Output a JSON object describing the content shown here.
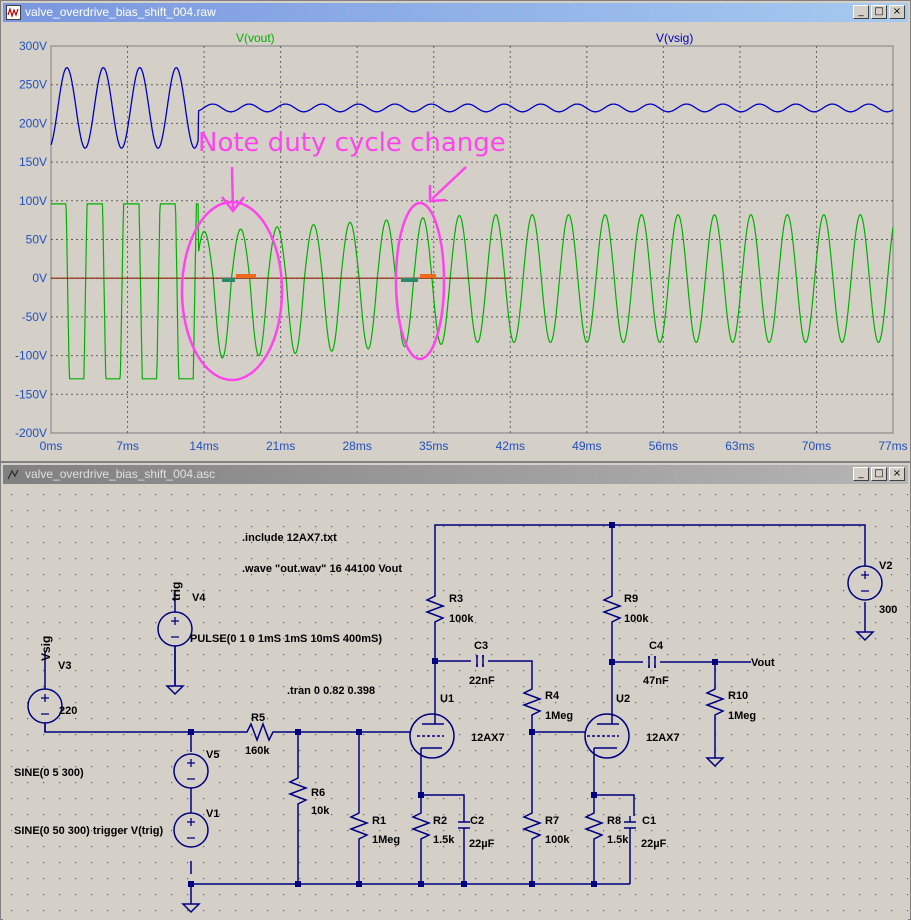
{
  "plot_window": {
    "title": "valve_overdrive_bias_shift_004.raw",
    "controls": {
      "minimize": "_",
      "maximize": "□",
      "close": "×"
    }
  },
  "schematic_window": {
    "title": "valve_overdrive_bias_shift_004.asc",
    "controls": {
      "minimize": "_",
      "maximize": "□",
      "close": "×"
    }
  },
  "chart_data": {
    "type": "line",
    "xlim": [
      0,
      77
    ],
    "ylim": [
      -200,
      300
    ],
    "grid": true,
    "x_ticks": [
      "0ms",
      "7ms",
      "14ms",
      "21ms",
      "28ms",
      "35ms",
      "42ms",
      "49ms",
      "56ms",
      "63ms",
      "70ms",
      "77ms"
    ],
    "y_ticks": [
      "300V",
      "250V",
      "200V",
      "150V",
      "100V",
      "50V",
      "0V",
      "-50V",
      "-100V",
      "-150V",
      "-200V"
    ],
    "series": [
      {
        "name": "V(vout)",
        "color": "#00b000"
      },
      {
        "name": "V(vsig)",
        "color": "#0000c0"
      }
    ],
    "reference_line": {
      "y": 0,
      "x_end": 42,
      "color": "#8b2500"
    },
    "annotation": "Note duty cycle change",
    "annotation_color": "#ff44ee"
  },
  "schematic": {
    "directives": {
      "include": ".include 12AX7.txt",
      "wave": ".wave \"out.wav\" 16 44100 Vout",
      "tran": ".tran 0 0.82 0.398"
    },
    "labels": {
      "trig": "trig",
      "vsig": "Vsig",
      "vout": "Vout"
    },
    "sources": {
      "v1": {
        "name": "V1",
        "value": "SINE(0 50 300) trigger V(trig)"
      },
      "v2": {
        "name": "V2",
        "value": "300"
      },
      "v3": {
        "name": "V3",
        "value": "220"
      },
      "v4": {
        "name": "V4",
        "value": "PULSE(0 1 0 1mS 1mS 10mS 400mS)"
      },
      "v5": {
        "name": "V5",
        "value": "SINE(0 5 300)"
      }
    },
    "resistors": {
      "r1": {
        "name": "R1",
        "value": "1Meg"
      },
      "r2": {
        "name": "R2",
        "value": "1.5k"
      },
      "r3": {
        "name": "R3",
        "value": "100k"
      },
      "r4": {
        "name": "R4",
        "value": "1Meg"
      },
      "r5": {
        "name": "R5",
        "value": "160k"
      },
      "r6": {
        "name": "R6",
        "value": "10k"
      },
      "r7": {
        "name": "R7",
        "value": "100k"
      },
      "r8": {
        "name": "R8",
        "value": "1.5k"
      },
      "r9": {
        "name": "R9",
        "value": "100k"
      },
      "r10": {
        "name": "R10",
        "value": "1Meg"
      }
    },
    "capacitors": {
      "c1": {
        "name": "C1",
        "value": "22µF"
      },
      "c2": {
        "name": "C2",
        "value": "22µF"
      },
      "c3": {
        "name": "C3",
        "value": "22nF"
      },
      "c4": {
        "name": "C4",
        "value": "47nF"
      }
    },
    "tubes": {
      "u1": {
        "name": "U1",
        "value": "12AX7"
      },
      "u2": {
        "name": "U2",
        "value": "12AX7"
      }
    }
  }
}
